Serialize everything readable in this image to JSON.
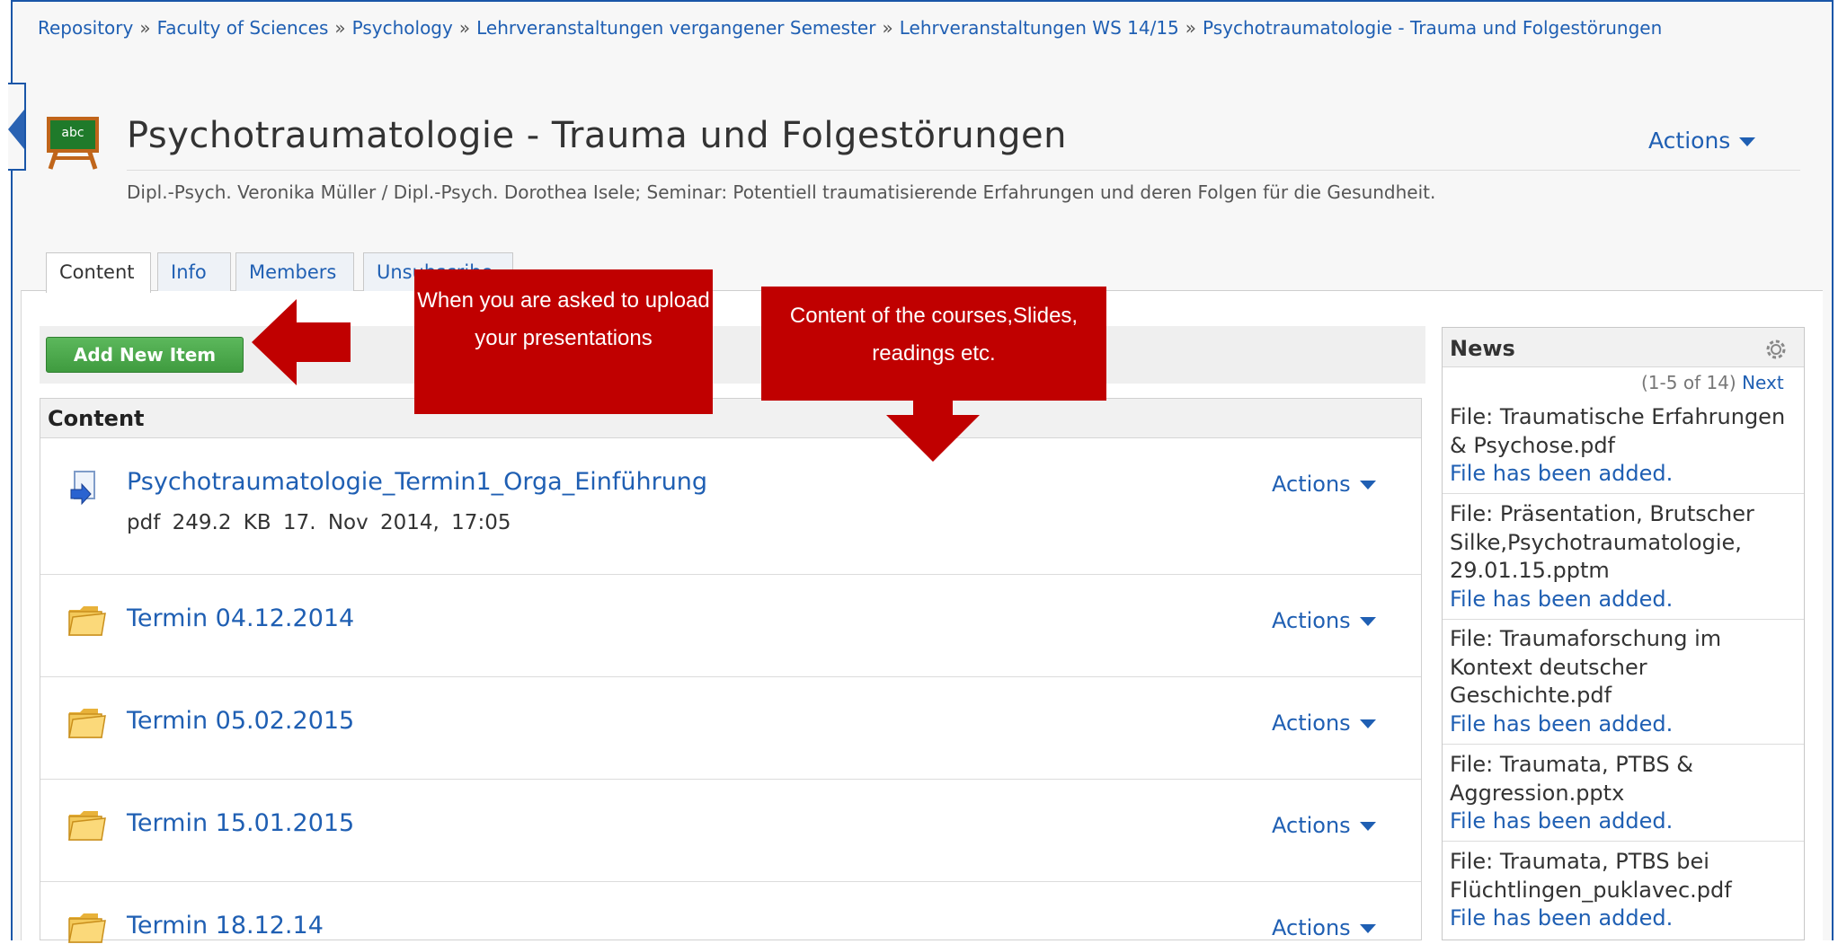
{
  "breadcrumb": {
    "items": [
      "Repository",
      "Faculty of Sciences",
      "Psychology",
      "Lehrveranstaltungen vergangener Semester",
      "Lehrveranstaltungen WS 14/15",
      "Psychotraumatologie - Trauma und Folgestörungen"
    ],
    "separator": "»"
  },
  "header": {
    "title": "Psychotraumatologie - Trauma und Folgestörungen",
    "actions_label": "Actions",
    "subtitle": "Dipl.-Psych. Veronika Müller / Dipl.-Psych. Dorothea Isele; Seminar: Potentiell traumatisierende Erfahrungen und deren Folgen für die Gesundheit.",
    "icon": "chalkboard-easel-icon",
    "icon_text": "abc"
  },
  "tabs": [
    {
      "label": "Content",
      "active": true
    },
    {
      "label": "Info",
      "active": false
    },
    {
      "label": "Members",
      "active": false
    },
    {
      "label": "Unsubscribe",
      "active": false
    }
  ],
  "toolbar": {
    "add_new_item_label": "Add New Item"
  },
  "content": {
    "header": "Content",
    "items": [
      {
        "name": "Psychotraumatologie_Termin1_Orga_Einführung",
        "type": "file",
        "meta": "pdf 249.2 KB 17. Nov 2014, 17:05",
        "actions": "Actions",
        "icon": "pdf-download-icon"
      },
      {
        "name": "Termin 04.12.2014",
        "type": "folder",
        "actions": "Actions",
        "icon": "folder-icon"
      },
      {
        "name": "Termin 05.02.2015",
        "type": "folder",
        "actions": "Actions",
        "icon": "folder-icon"
      },
      {
        "name": "Termin 15.01.2015",
        "type": "folder",
        "actions": "Actions",
        "icon": "folder-icon"
      },
      {
        "name": "Termin 18.12.14",
        "type": "folder",
        "actions": "Actions",
        "icon": "folder-icon"
      }
    ]
  },
  "news": {
    "title": "News",
    "count": "(1-5 of 14)",
    "next": "Next",
    "items": [
      {
        "title": "File: Traumatische Erfahrungen & Psychose.pdf",
        "status": "File has been added."
      },
      {
        "title": "File: Präsentation, Brutscher Silke,Psychotraumatologie, 29.01.15.pptm",
        "status": "File has been added."
      },
      {
        "title": "File: Traumaforschung im Kontext deutscher Geschichte.pdf",
        "status": "File has been added."
      },
      {
        "title": "File: Traumata, PTBS & Aggression.pptx",
        "status": "File has been added."
      },
      {
        "title": "File: Traumata, PTBS bei Flüchtlingen_puklavec.pdf",
        "status": "File has been added."
      }
    ]
  },
  "annotations": {
    "upload_callout": "When you are asked to upload your presentations",
    "content_callout": "Content of the courses,Slides, readings etc.",
    "color": "#c00000"
  }
}
